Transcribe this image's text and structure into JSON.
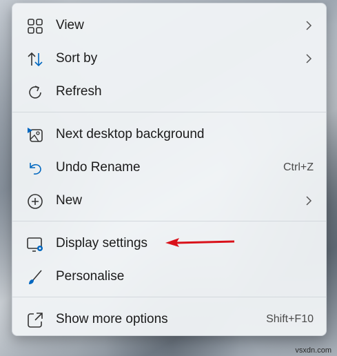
{
  "menu": {
    "items": [
      {
        "label": "View",
        "icon": "grid-icon",
        "submenu": true
      },
      {
        "label": "Sort by",
        "icon": "sort-icon",
        "submenu": true
      },
      {
        "label": "Refresh",
        "icon": "refresh-icon"
      },
      {
        "label": "Next desktop background",
        "icon": "next-background-icon"
      },
      {
        "label": "Undo Rename",
        "icon": "undo-icon",
        "shortcut": "Ctrl+Z"
      },
      {
        "label": "New",
        "icon": "new-plus-icon",
        "submenu": true
      },
      {
        "label": "Display settings",
        "icon": "display-settings-icon"
      },
      {
        "label": "Personalise",
        "icon": "brush-icon"
      },
      {
        "label": "Show more options",
        "icon": "share-icon",
        "shortcut": "Shift+F10"
      }
    ]
  },
  "annotation": {
    "arrow": "red-arrow-pointing-left",
    "color": "#d9111a"
  },
  "watermark": "vsxdn.com",
  "colors": {
    "accent": "#0067c0",
    "menu_bg": "#f0f3f6",
    "text": "#1b1b1b"
  }
}
